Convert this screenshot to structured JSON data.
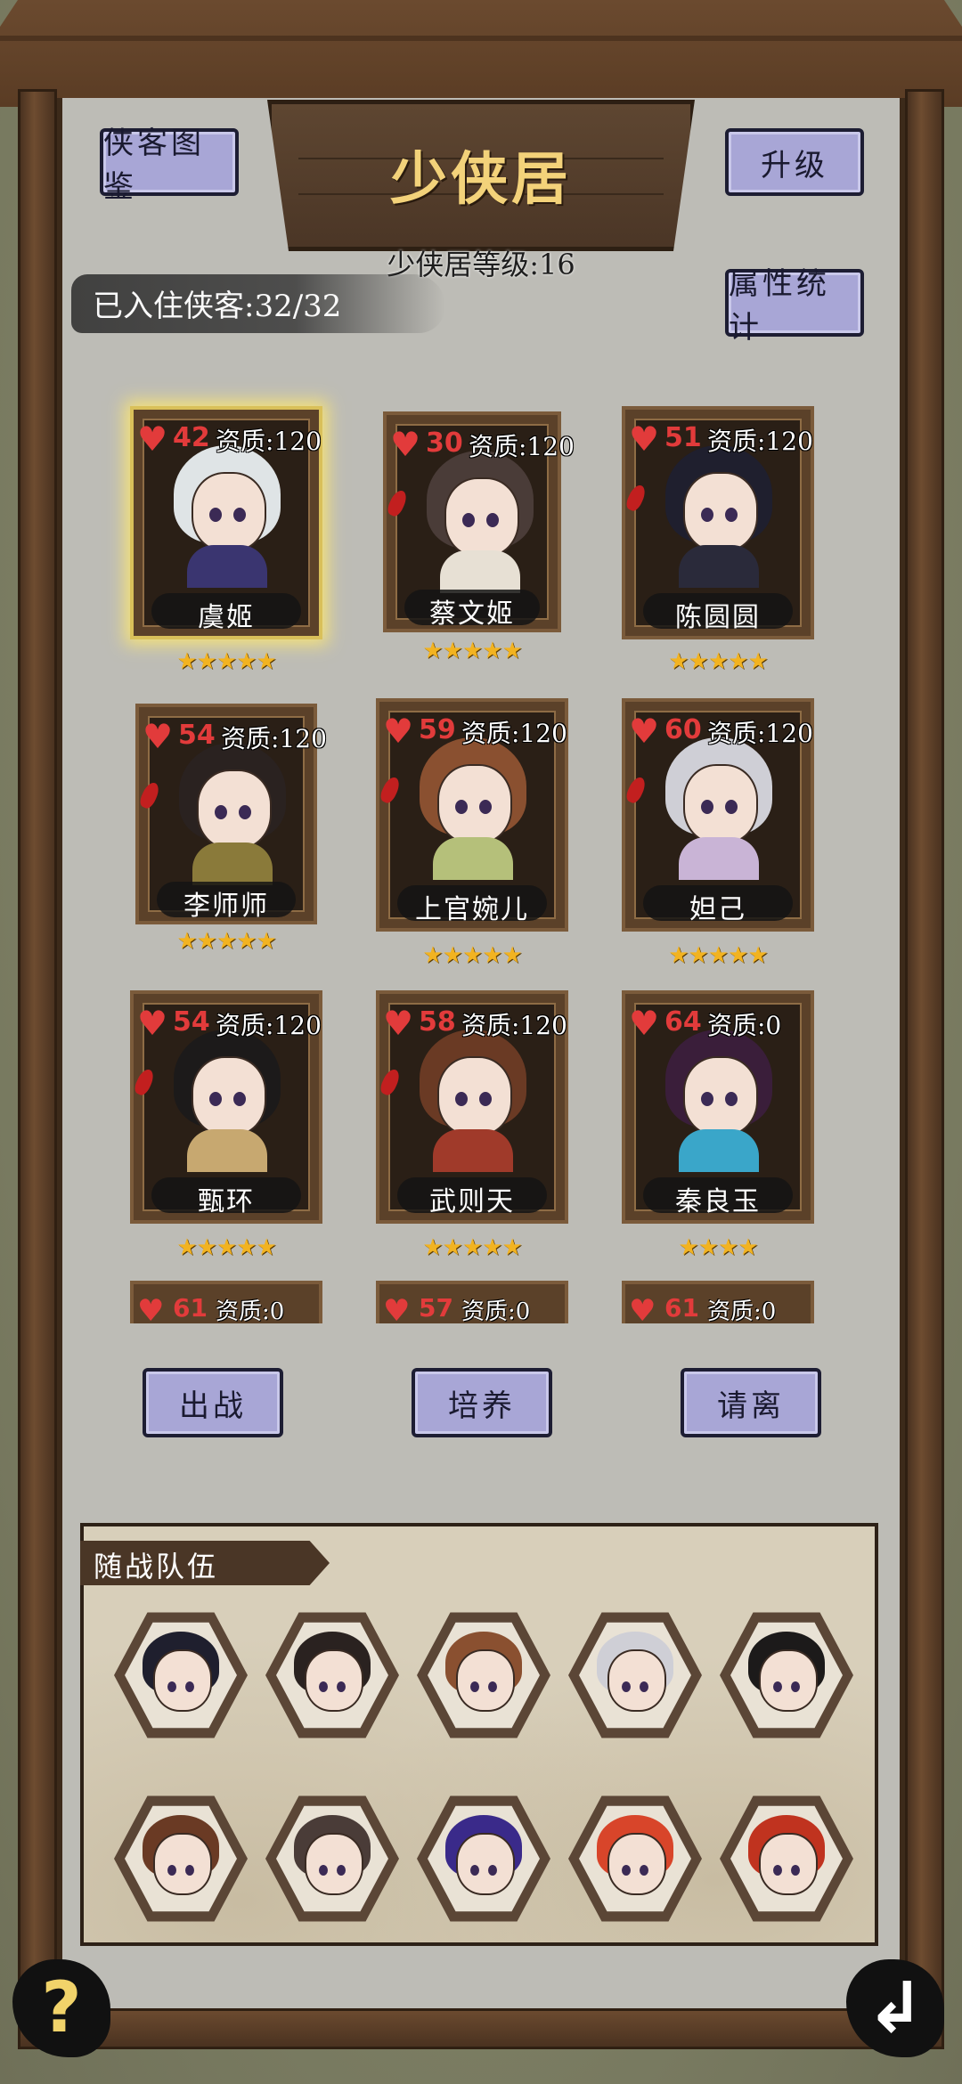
{
  "header": {
    "title": "少侠居",
    "level_text": "少侠居等级:16",
    "resident_text": "已入住侠客:32/32",
    "handbook_label": "侠客图鉴",
    "upgrade_label": "升级",
    "stats_label": "属性统计"
  },
  "heroes": [
    {
      "hp": "42",
      "aptitude": "资质:120",
      "name": "虞姬",
      "stars": "★★★★★"
    },
    {
      "hp": "30",
      "aptitude": "资质:120",
      "name": "蔡文姬",
      "stars": "★★★★★"
    },
    {
      "hp": "51",
      "aptitude": "资质:120",
      "name": "陈圆圆",
      "stars": "★★★★★"
    },
    {
      "hp": "54",
      "aptitude": "资质:120",
      "name": "李师师",
      "stars": "★★★★★"
    },
    {
      "hp": "59",
      "aptitude": "资质:120",
      "name": "上官婉儿",
      "stars": "★★★★★"
    },
    {
      "hp": "60",
      "aptitude": "资质:120",
      "name": "妲己",
      "stars": "★★★★★"
    },
    {
      "hp": "54",
      "aptitude": "资质:120",
      "name": "甄环",
      "stars": "★★★★★"
    },
    {
      "hp": "58",
      "aptitude": "资质:120",
      "name": "武则天",
      "stars": "★★★★★"
    },
    {
      "hp": "64",
      "aptitude": "资质:0",
      "name": "秦良玉",
      "stars": "★★★★"
    }
  ],
  "partial_heroes": [
    {
      "hp": "61",
      "aptitude": "资质:0"
    },
    {
      "hp": "57",
      "aptitude": "资质:0"
    },
    {
      "hp": "61",
      "aptitude": "资质:0"
    }
  ],
  "actions": {
    "deploy_label": "出战",
    "train_label": "培养",
    "dismiss_label": "请离"
  },
  "team": {
    "label": "随战队伍"
  },
  "corners": {
    "help_icon": "?",
    "back_icon": "↲"
  },
  "colors": {
    "heart": "#e23b3b",
    "button_bg": "#a8a6d6",
    "title_gold": "#f3d27a",
    "star": "#f2b321"
  }
}
